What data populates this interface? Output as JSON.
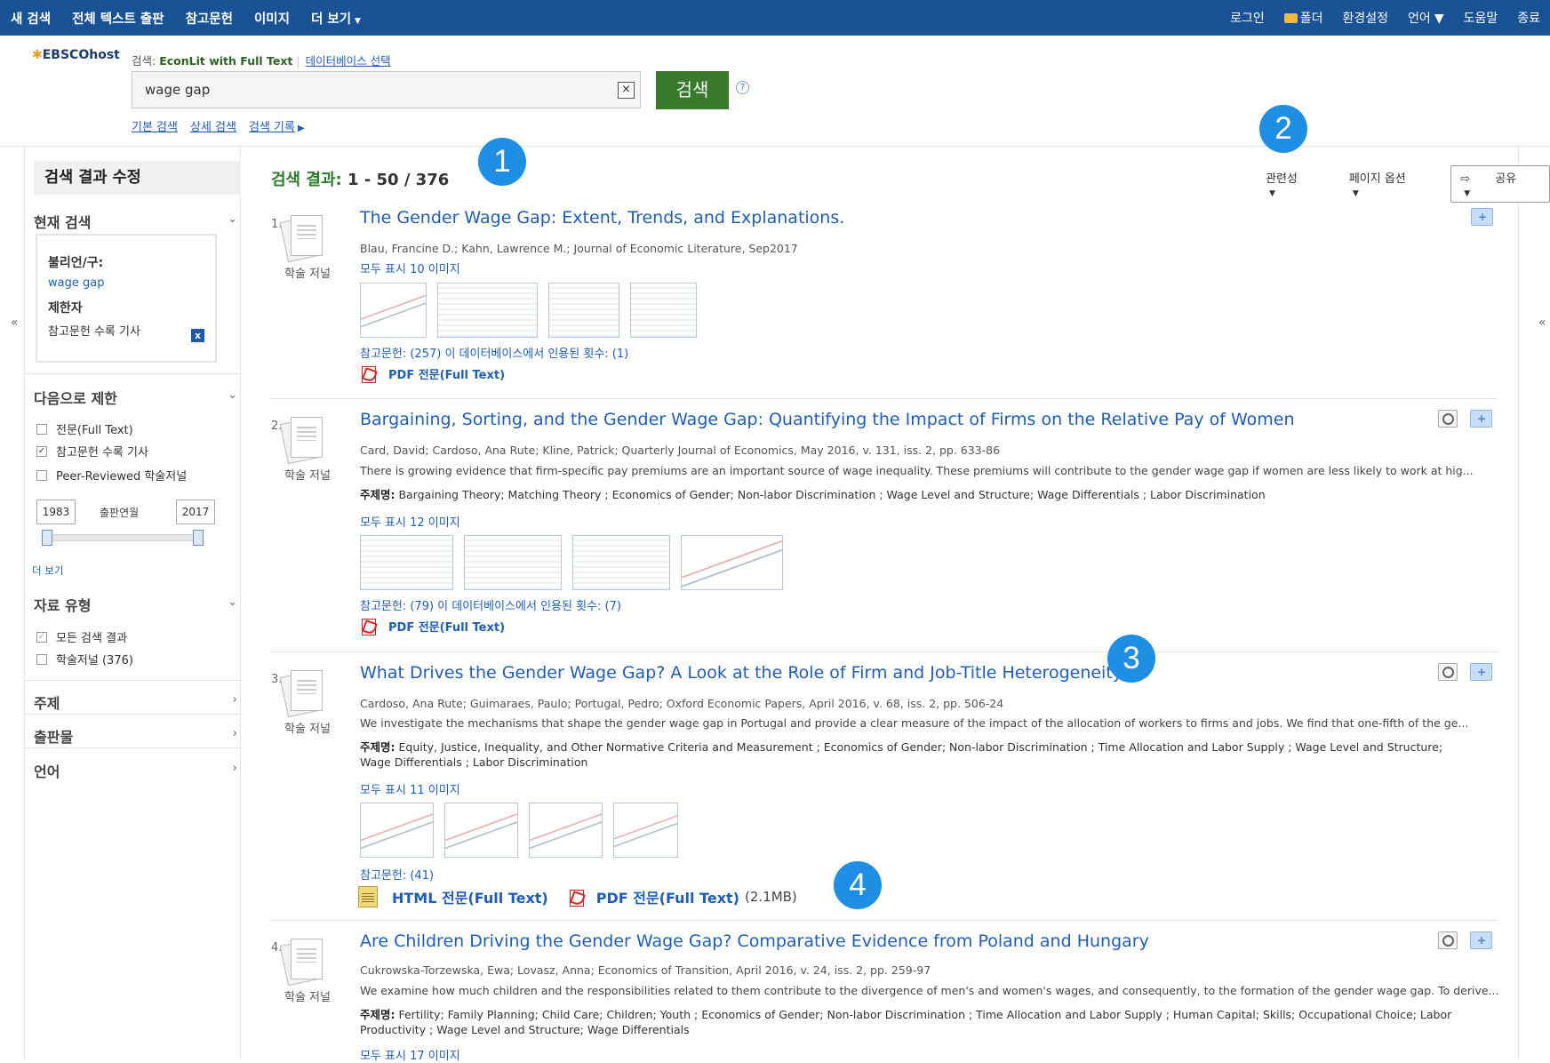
{
  "topnav": {
    "left": [
      "새 검색",
      "전체 텍스트 출판",
      "참고문헌",
      "이미지",
      "더 보기"
    ],
    "right": [
      "로그인",
      "폴더",
      "환경설정",
      "언어",
      "도움말",
      "종료"
    ]
  },
  "header": {
    "logo": "EBSCOhost",
    "search_prefix": "검색:",
    "database": "EconLit with Full Text",
    "db_select": "데이터베이스 선택",
    "query": "wage gap",
    "clear": "×",
    "search_button": "검색",
    "help": "?",
    "links": [
      "기본 검색",
      "상세 검색",
      "검색 기록"
    ]
  },
  "badges": [
    "1",
    "2",
    "3",
    "4"
  ],
  "sidebar": {
    "collapse": "«",
    "refine": "검색 결과 수정",
    "current_search": "현재 검색",
    "boolean_label": "불리언/구:",
    "boolean_value": "wage gap",
    "limiters_label": "제한자",
    "limiter_value": "참고문헌 수록 기사",
    "remove": "x",
    "limit_to": "다음으로 제한",
    "checks": [
      "전문(Full Text)",
      "참고문헌 수록 기사",
      "Peer-Reviewed 학술저널"
    ],
    "year_from": "1983",
    "year_label": "출판연월",
    "year_to": "2017",
    "more": "더 보기",
    "source_types": "자료 유형",
    "source_checks": [
      "모든 검색 결과",
      "학술저널 (376)"
    ],
    "facets": [
      "주제",
      "출판물",
      "언어"
    ]
  },
  "results_header": {
    "label": "검색 결과:",
    "range": "1 - 50 / 376"
  },
  "toolbar": {
    "sort": "관련성",
    "page_options": "페이지 옵션",
    "share": "공유"
  },
  "results": [
    {
      "num": "1.",
      "type": "학술 저널",
      "title": "The Gender Wage Gap: Extent, Trends, and Explanations.",
      "meta": "Blau, Francine D.; Kahn, Lawrence M.; Journal of Economic Literature, Sep2017",
      "images": "모두 표시 10 이미지",
      "refs": "참고문헌: (257) 이 데이터베이스에서 인용된 횟수: (1)",
      "pdf": "PDF 전문(Full Text)"
    },
    {
      "num": "2.",
      "type": "학술 저널",
      "title": "Bargaining, Sorting, and the Gender Wage Gap: Quantifying the Impact of Firms on the Relative Pay of Women",
      "meta": "Card, David; Cardoso, Ana Rute; Kline, Patrick; Quarterly Journal of Economics, May 2016, v. 131, iss. 2, pp. 633-86",
      "desc": "There is growing evidence that firm-specific pay premiums are an important source of wage inequality. These premiums will contribute to the gender wage gap if women are less likely to work at hig...",
      "subj_label": "주제명:",
      "subjects": "Bargaining Theory; Matching Theory ; Economics of Gender; Non-labor Discrimination ; Wage Level and Structure; Wage Differentials ; Labor Discrimination",
      "images": "모두 표시 12 이미지",
      "refs": "참고문헌: (79) 이 데이터베이스에서 인용된 횟수: (7)",
      "pdf": "PDF 전문(Full Text)"
    },
    {
      "num": "3.",
      "type": "학술 저널",
      "title": "What Drives the Gender Wage Gap? A Look at the Role of Firm and Job-Title Heterogeneity",
      "meta": "Cardoso, Ana Rute; Guimaraes, Paulo; Portugal, Pedro; Oxford Economic Papers, April 2016, v. 68, iss. 2, pp. 506-24",
      "desc": "We investigate the mechanisms that shape the gender wage gap in Portugal and provide a clear measure of the impact of the allocation of workers to firms and jobs. We find that one-fifth of the ge...",
      "subj_label": "주제명:",
      "subjects": "Equity, Justice, Inequality, and Other Normative Criteria and Measurement ; Economics of Gender; Non-labor Discrimination ; Time Allocation and Labor Supply ; Wage Level and Structure; Wage Differentials ; Labor Discrimination",
      "images": "모두 표시 11 이미지",
      "refs": "참고문헌: (41)",
      "html": "HTML 전문(Full Text)",
      "pdf": "PDF 전문(Full Text)",
      "pdf_size": "(2.1MB)"
    },
    {
      "num": "4.",
      "type": "학술 저널",
      "title": "Are Children Driving the Gender Wage Gap? Comparative Evidence from Poland and Hungary",
      "meta": "Cukrowska-Torzewska, Ewa; Lovasz, Anna; Economics of Transition, April 2016, v. 24, iss. 2, pp. 259-97",
      "desc": "We examine how much children and the responsibilities related to them contribute to the divergence of men's and women's wages, and consequently, to the formation of the gender wage gap. To derive...",
      "subj_label": "주제명:",
      "subjects": "Fertility; Family Planning; Child Care; Children; Youth ; Economics of Gender; Non-labor Discrimination ; Time Allocation and Labor Supply ; Human Capital; Skills; Occupational Choice; Labor Productivity ; Wage Level and Structure; Wage Differentials",
      "images": "모두 표시 17 이미지"
    }
  ]
}
